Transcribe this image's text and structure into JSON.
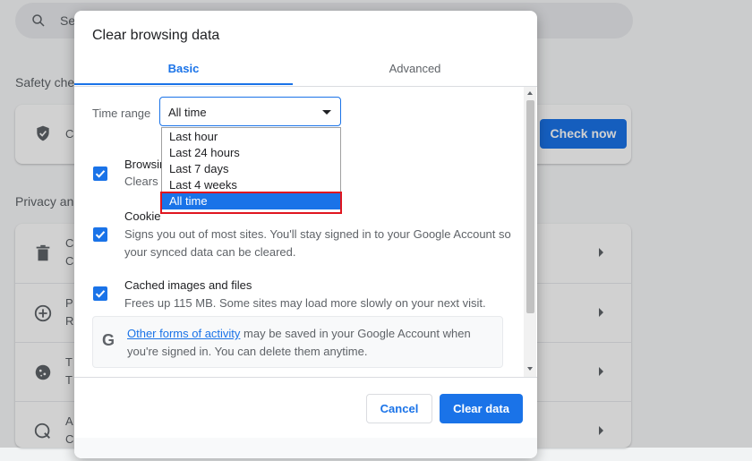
{
  "background": {
    "search_placeholder": "Se",
    "safety_section": "Safety che",
    "safety_card_text": "C",
    "check_now": "Check now",
    "privacy_section": "Privacy an",
    "rows": [
      {
        "icon": "trash-icon",
        "title": "C",
        "sub": "C"
      },
      {
        "icon": "cookie-plus-icon",
        "title": "P",
        "sub": "R"
      },
      {
        "icon": "cookie-icon",
        "title": "T",
        "sub": "T"
      },
      {
        "icon": "security-icon",
        "title": "A",
        "sub": "C"
      }
    ]
  },
  "dialog": {
    "title": "Clear browsing data",
    "tabs": [
      "Basic",
      "Advanced"
    ],
    "active_tab": "Basic",
    "time_range_label": "Time range",
    "time_range_value": "All time",
    "items": [
      {
        "title": "Browsing history",
        "visible_title": "Browsin",
        "desc": "Clears h",
        "checked": true
      },
      {
        "title": "Cookies and other site data",
        "visible_title": "Cookie",
        "desc": "Signs you out of most sites. You'll stay signed in to your Google Account so your synced data can be cleared.",
        "checked": true
      },
      {
        "title": "Cached images and files",
        "visible_title": "Cached images and files",
        "desc": "Frees up 115 MB. Some sites may load more slowly on your next visit.",
        "checked": true
      }
    ],
    "info": {
      "link": "Other forms of activity",
      "text": " may be saved in your Google Account when you're signed in. You can delete them anytime."
    },
    "buttons": {
      "cancel": "Cancel",
      "clear": "Clear data"
    }
  },
  "dropdown": {
    "options": [
      "Last hour",
      "Last 24 hours",
      "Last 7 days",
      "Last 4 weeks",
      "All time"
    ],
    "selected": "All time"
  },
  "colors": {
    "accent": "#1a73e8",
    "highlight": "#e0161f"
  }
}
